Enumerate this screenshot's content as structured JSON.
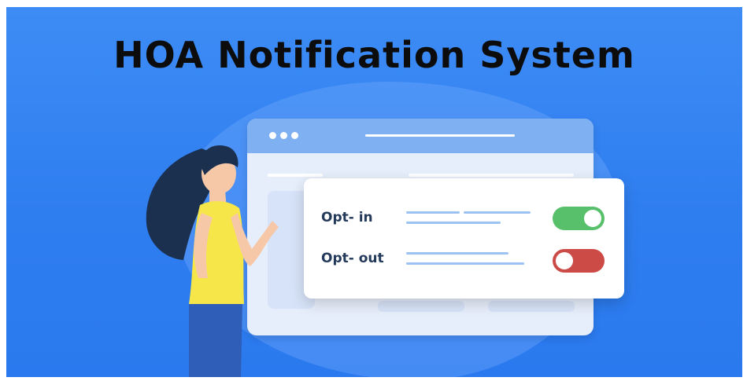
{
  "title": "HOA Notification System",
  "options": [
    {
      "label": "Opt- in",
      "state": "on",
      "color": "#58c06a"
    },
    {
      "label": "Opt- out",
      "state": "off",
      "color": "#cc4b47"
    }
  ],
  "colors": {
    "background": "#3385f2",
    "browser_bar": "#7fb1f2",
    "shirt": "#f7e64a",
    "hair": "#1b2f4f",
    "pants": "#2f5eb8"
  }
}
